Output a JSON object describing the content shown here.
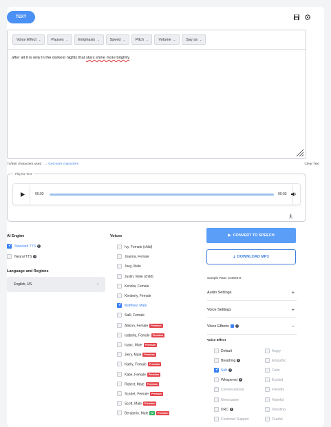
{
  "tabs": {
    "active": "TEXT"
  },
  "toolbar": {
    "buttons": [
      "Voice Effect",
      "Pauses",
      "Emphasis",
      "Speed",
      "Pitch",
      "Volume",
      "Say as"
    ]
  },
  "editor": {
    "text_start": "after all it is only in the darkest nights that ",
    "text_err": "stars shine more brightly"
  },
  "counter": {
    "used": "74/550 characters used",
    "more": "Get more characters"
  },
  "clear_label": "Clear Text",
  "player": {
    "legend": "Play the Text",
    "current": "00:03",
    "total": "00:03",
    "progress": 1.0
  },
  "ai_engine": {
    "label": "AI Engine",
    "options": [
      {
        "label": "Standard TTS",
        "checked": true
      },
      {
        "label": "Neural TTS",
        "checked": false
      }
    ]
  },
  "language": {
    "label": "Language and Regions",
    "value": "English, US"
  },
  "voices": {
    "label": "Voices",
    "items": [
      {
        "name": "Ivy, Female (child)",
        "checked": false,
        "premium": false,
        "ai": false
      },
      {
        "name": "Joanna, Female",
        "checked": false,
        "premium": false,
        "ai": false
      },
      {
        "name": "Joey, Male",
        "checked": false,
        "premium": false,
        "ai": false
      },
      {
        "name": "Justin, Male (child)",
        "checked": false,
        "premium": false,
        "ai": false
      },
      {
        "name": "Kendra, Female",
        "checked": false,
        "premium": false,
        "ai": false
      },
      {
        "name": "Kimberly, Female",
        "checked": false,
        "premium": false,
        "ai": false
      },
      {
        "name": "Matthew, Male",
        "checked": true,
        "premium": false,
        "ai": false
      },
      {
        "name": "Salli, Female",
        "checked": false,
        "premium": false,
        "ai": false
      },
      {
        "name": "Allison, Female",
        "checked": false,
        "premium": true,
        "ai": false
      },
      {
        "name": "Isabella, Female",
        "checked": false,
        "premium": true,
        "ai": false
      },
      {
        "name": "Isaac, Male",
        "checked": false,
        "premium": true,
        "ai": false
      },
      {
        "name": "Jerry, Male",
        "checked": false,
        "premium": true,
        "ai": false
      },
      {
        "name": "Kathy, Female",
        "checked": false,
        "premium": true,
        "ai": false
      },
      {
        "name": "Katie, Female",
        "checked": false,
        "premium": true,
        "ai": false
      },
      {
        "name": "Robert, Male",
        "checked": false,
        "premium": true,
        "ai": false
      },
      {
        "name": "Scarlet, Female",
        "checked": false,
        "premium": true,
        "ai": false
      },
      {
        "name": "Scott, Male",
        "checked": false,
        "premium": true,
        "ai": false
      },
      {
        "name": "Benjamin, Male",
        "checked": false,
        "premium": true,
        "ai": true
      }
    ],
    "premium_label": "Premium",
    "ai_label": "AI"
  },
  "actions": {
    "convert": "CONVERT TO SPEECH",
    "download": "DOWNLOAD MP3",
    "sample_rate": "Sample Rate: 24000Hz"
  },
  "accordions": [
    {
      "label": "Audio Settings",
      "symbol": "+"
    },
    {
      "label": "Voice Settings",
      "symbol": "+"
    },
    {
      "label": "Voice Effects",
      "symbol": "−"
    }
  ],
  "voice_effect": {
    "label": "Voice Effect",
    "left": [
      {
        "label": "Default",
        "state": "normal",
        "info": false
      },
      {
        "label": "Breathing",
        "state": "normal",
        "info": true
      },
      {
        "label": "Soft",
        "state": "checked",
        "info": true
      },
      {
        "label": "Whispered",
        "state": "normal",
        "info": true
      },
      {
        "label": "Conversational",
        "state": "disabled",
        "info": false
      },
      {
        "label": "Newscaster",
        "state": "disabled",
        "info": false
      },
      {
        "label": "DRC",
        "state": "normal",
        "info": true
      },
      {
        "label": "Customer Support",
        "state": "disabled",
        "info": false
      }
    ],
    "right": [
      "Angry",
      "Empathic",
      "Calm",
      "Excited",
      "Friendly",
      "Hopeful",
      "Shouting",
      "Fearful"
    ]
  },
  "colors": {
    "accent": "#4a90f5",
    "premium": "#e4434a",
    "ai": "#2fb35f"
  }
}
